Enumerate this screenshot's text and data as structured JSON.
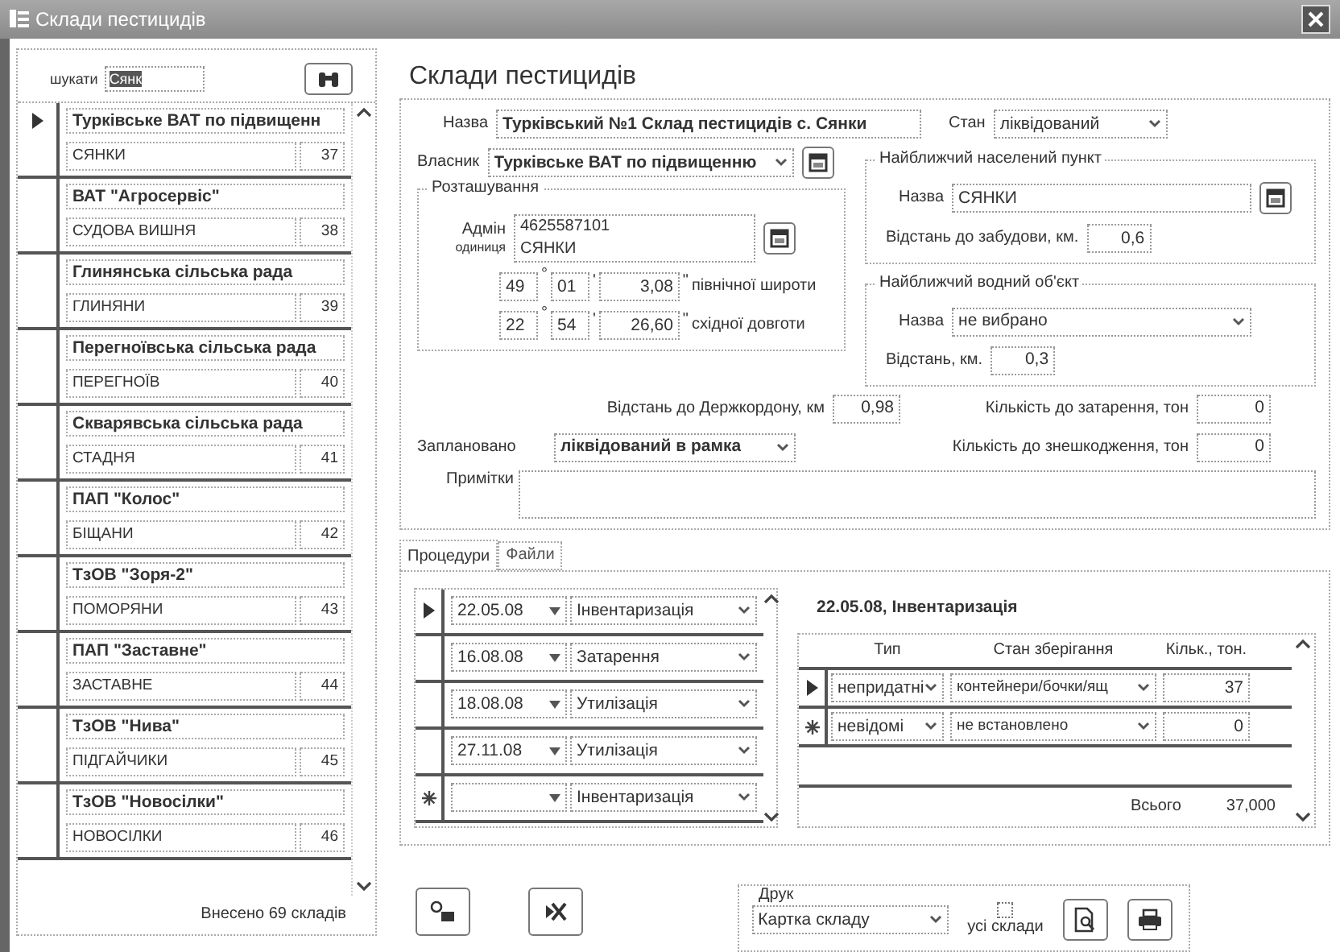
{
  "window": {
    "title": "Склади пестицидів"
  },
  "sidebar": {
    "search_label": "шукати",
    "search_value": "Сянк",
    "records": [
      {
        "owner": "Турківське ВАТ по підвищенн",
        "village": "СЯНКИ",
        "number": "37",
        "selected": true
      },
      {
        "owner": "ВАТ \"Агросервіс\"",
        "village": "СУДОВА ВИШНЯ",
        "number": "38",
        "selected": false
      },
      {
        "owner": "Глинянська сільська рада",
        "village": "ГЛИНЯНИ",
        "number": "39",
        "selected": false
      },
      {
        "owner": "Перегноївська сільська рада",
        "village": "ПЕРЕГНОЇВ",
        "number": "40",
        "selected": false
      },
      {
        "owner": "Скварявська сільська рада",
        "village": "СТАДНЯ",
        "number": "41",
        "selected": false
      },
      {
        "owner": "ПАП \"Колос\"",
        "village": "БІЩАНИ",
        "number": "42",
        "selected": false
      },
      {
        "owner": "ТзОВ \"Зоря-2\"",
        "village": "ПОМОРЯНИ",
        "number": "43",
        "selected": false
      },
      {
        "owner": "ПАП \"Заставне\"",
        "village": "ЗАСТАВНЕ",
        "number": "44",
        "selected": false
      },
      {
        "owner": "ТзОВ \"Нива\"",
        "village": "ПІДГАЙЧИКИ",
        "number": "45",
        "selected": false
      },
      {
        "owner": "ТзОВ \"Новосілки\"",
        "village": "НОВОСІЛКИ",
        "number": "46",
        "selected": false
      }
    ],
    "footer": "Внесено 69 складів"
  },
  "page_title": "Склади пестицидів",
  "form": {
    "name": {
      "label": "Назва",
      "value": "Турківський №1 Склад пестицидів с. Сянки"
    },
    "state": {
      "label": "Стан",
      "value": "ліквідований"
    },
    "owner": {
      "label": "Власник",
      "value": "Турківське ВАТ по підвищенню"
    },
    "location": {
      "title": "Розташування",
      "label": "Адмін",
      "label_2": "одиниця",
      "code": "4625587101",
      "place": "СЯНКИ",
      "coordinates": [
        {
          "deg": "49",
          "deg_mark": "°",
          "min": "01",
          "min_mark": "'",
          "sec": "3,08",
          "sec_mark": "\"",
          "caption": "північної широти"
        },
        {
          "deg": "22",
          "deg_mark": "°",
          "min": "54",
          "min_mark": "'",
          "sec": "26,60",
          "sec_mark": "\"",
          "caption": "східної довготи"
        }
      ]
    },
    "settlement": {
      "title": "Найближчий населений пункт",
      "name_label": "Назва",
      "name": "СЯНКИ",
      "distance_label": "Відстань до забудови, км.",
      "distance": "0,6"
    },
    "water": {
      "title": "Найближчий водний об'єкт",
      "name_label": "Назва",
      "name": "не вибрано",
      "distance_label": "Відстань, км.",
      "distance": "0,3"
    },
    "border_distance": {
      "label": "Відстань до Держкордону, км",
      "value": "0,98"
    },
    "planned": {
      "label": "Заплановано",
      "value": "ліквідований в рамка"
    },
    "qty_packing": {
      "label": "Кількість до затарення, тон",
      "value": "0"
    },
    "qty_disposal": {
      "label": "Кількість до знешкодження, тон",
      "value": "0"
    },
    "notes": {
      "label": "Примітки"
    }
  },
  "tabs": [
    {
      "label": "Процедури",
      "selected": true
    },
    {
      "label": "Файли",
      "selected": false
    }
  ],
  "procedures": [
    {
      "kind": "entry",
      "date": "22.05.08",
      "type": "Інвентаризація",
      "selected": true
    },
    {
      "kind": "entry",
      "date": "16.08.08",
      "type": "Затарення",
      "selected": false
    },
    {
      "kind": "entry",
      "date": "18.08.08",
      "type": "Утилізація",
      "selected": false
    },
    {
      "kind": "entry",
      "date": "27.11.08",
      "type": "Утилізація",
      "selected": false
    },
    {
      "kind": "new",
      "type": "Інвентаризація",
      "selected": false
    }
  ],
  "detail": {
    "title": "22.05.08, Інвентаризація",
    "columns": [
      "Тип",
      "Стан зберігання",
      "Кільк., тон."
    ],
    "rows": [
      {
        "kind": "entry",
        "type": "непридатні",
        "storage": "контейнери/бочки/ящ",
        "amount": "37",
        "selected": true
      },
      {
        "kind": "new",
        "type": "невідомі",
        "storage": "не встановлено",
        "amount": "0",
        "selected": false
      }
    ],
    "total_label": "Всього",
    "total": "37,000"
  },
  "print": {
    "title": "Друк",
    "report": "Картка складу",
    "all_label": "усі склади",
    "all_checked": false
  }
}
